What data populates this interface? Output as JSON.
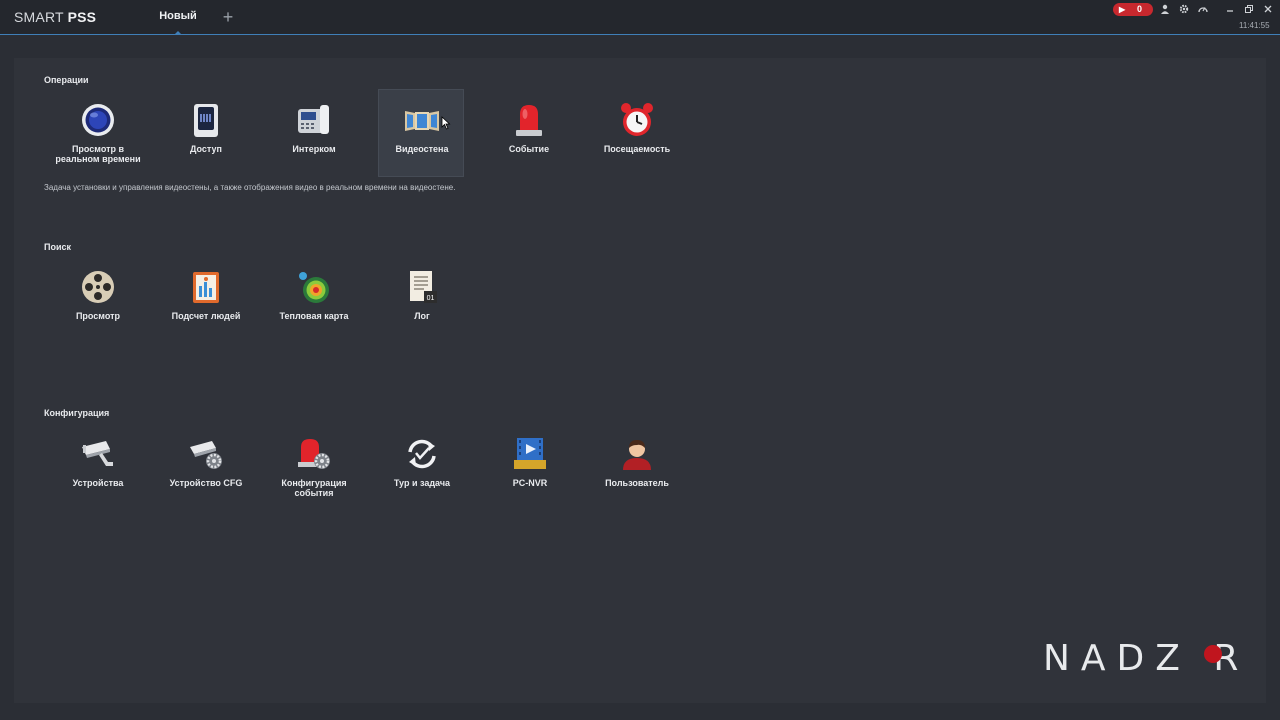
{
  "app": {
    "brand_light": "SMART ",
    "brand_bold": "PSS",
    "tab_label": "Новый",
    "add_tab": "+",
    "alarm_count": "0",
    "time": "11:41:55"
  },
  "sections": {
    "operations": {
      "title": "Операции",
      "items": [
        {
          "label": "Просмотр в реальном времени",
          "icon": "live-view-icon"
        },
        {
          "label": "Доступ",
          "icon": "access-control-icon"
        },
        {
          "label": "Интерком",
          "icon": "intercom-icon"
        },
        {
          "label": "Видеостена",
          "icon": "video-wall-icon"
        },
        {
          "label": "Событие",
          "icon": "alarm-light-icon"
        },
        {
          "label": "Посещаемость",
          "icon": "alarm-clock-icon"
        }
      ],
      "description": "Задача установки и управления видеостены, а также отображения видео в реальном времени на видеостене."
    },
    "search": {
      "title": "Поиск",
      "items": [
        {
          "label": "Просмотр",
          "icon": "film-reel-icon"
        },
        {
          "label": "Подсчет людей",
          "icon": "people-counting-icon"
        },
        {
          "label": "Тепловая карта",
          "icon": "heatmap-icon"
        },
        {
          "label": "Лог",
          "icon": "log-icon"
        }
      ]
    },
    "config": {
      "title": "Конфигурация",
      "items": [
        {
          "label": "Устройства",
          "icon": "camera-device-icon"
        },
        {
          "label": "Устройство CFG",
          "icon": "camera-settings-icon"
        },
        {
          "label": "Конфигурация события",
          "icon": "event-config-icon"
        },
        {
          "label": "Тур и задача",
          "icon": "tour-task-icon"
        },
        {
          "label": "PC-NVR",
          "icon": "pc-nvr-icon"
        },
        {
          "label": "Пользователь",
          "icon": "user-icon"
        }
      ]
    }
  },
  "watermark": "NADZ R",
  "colors": {
    "accent": "#3f7fb8",
    "alarm_red": "#c8282e",
    "background": "#2b2e35"
  }
}
